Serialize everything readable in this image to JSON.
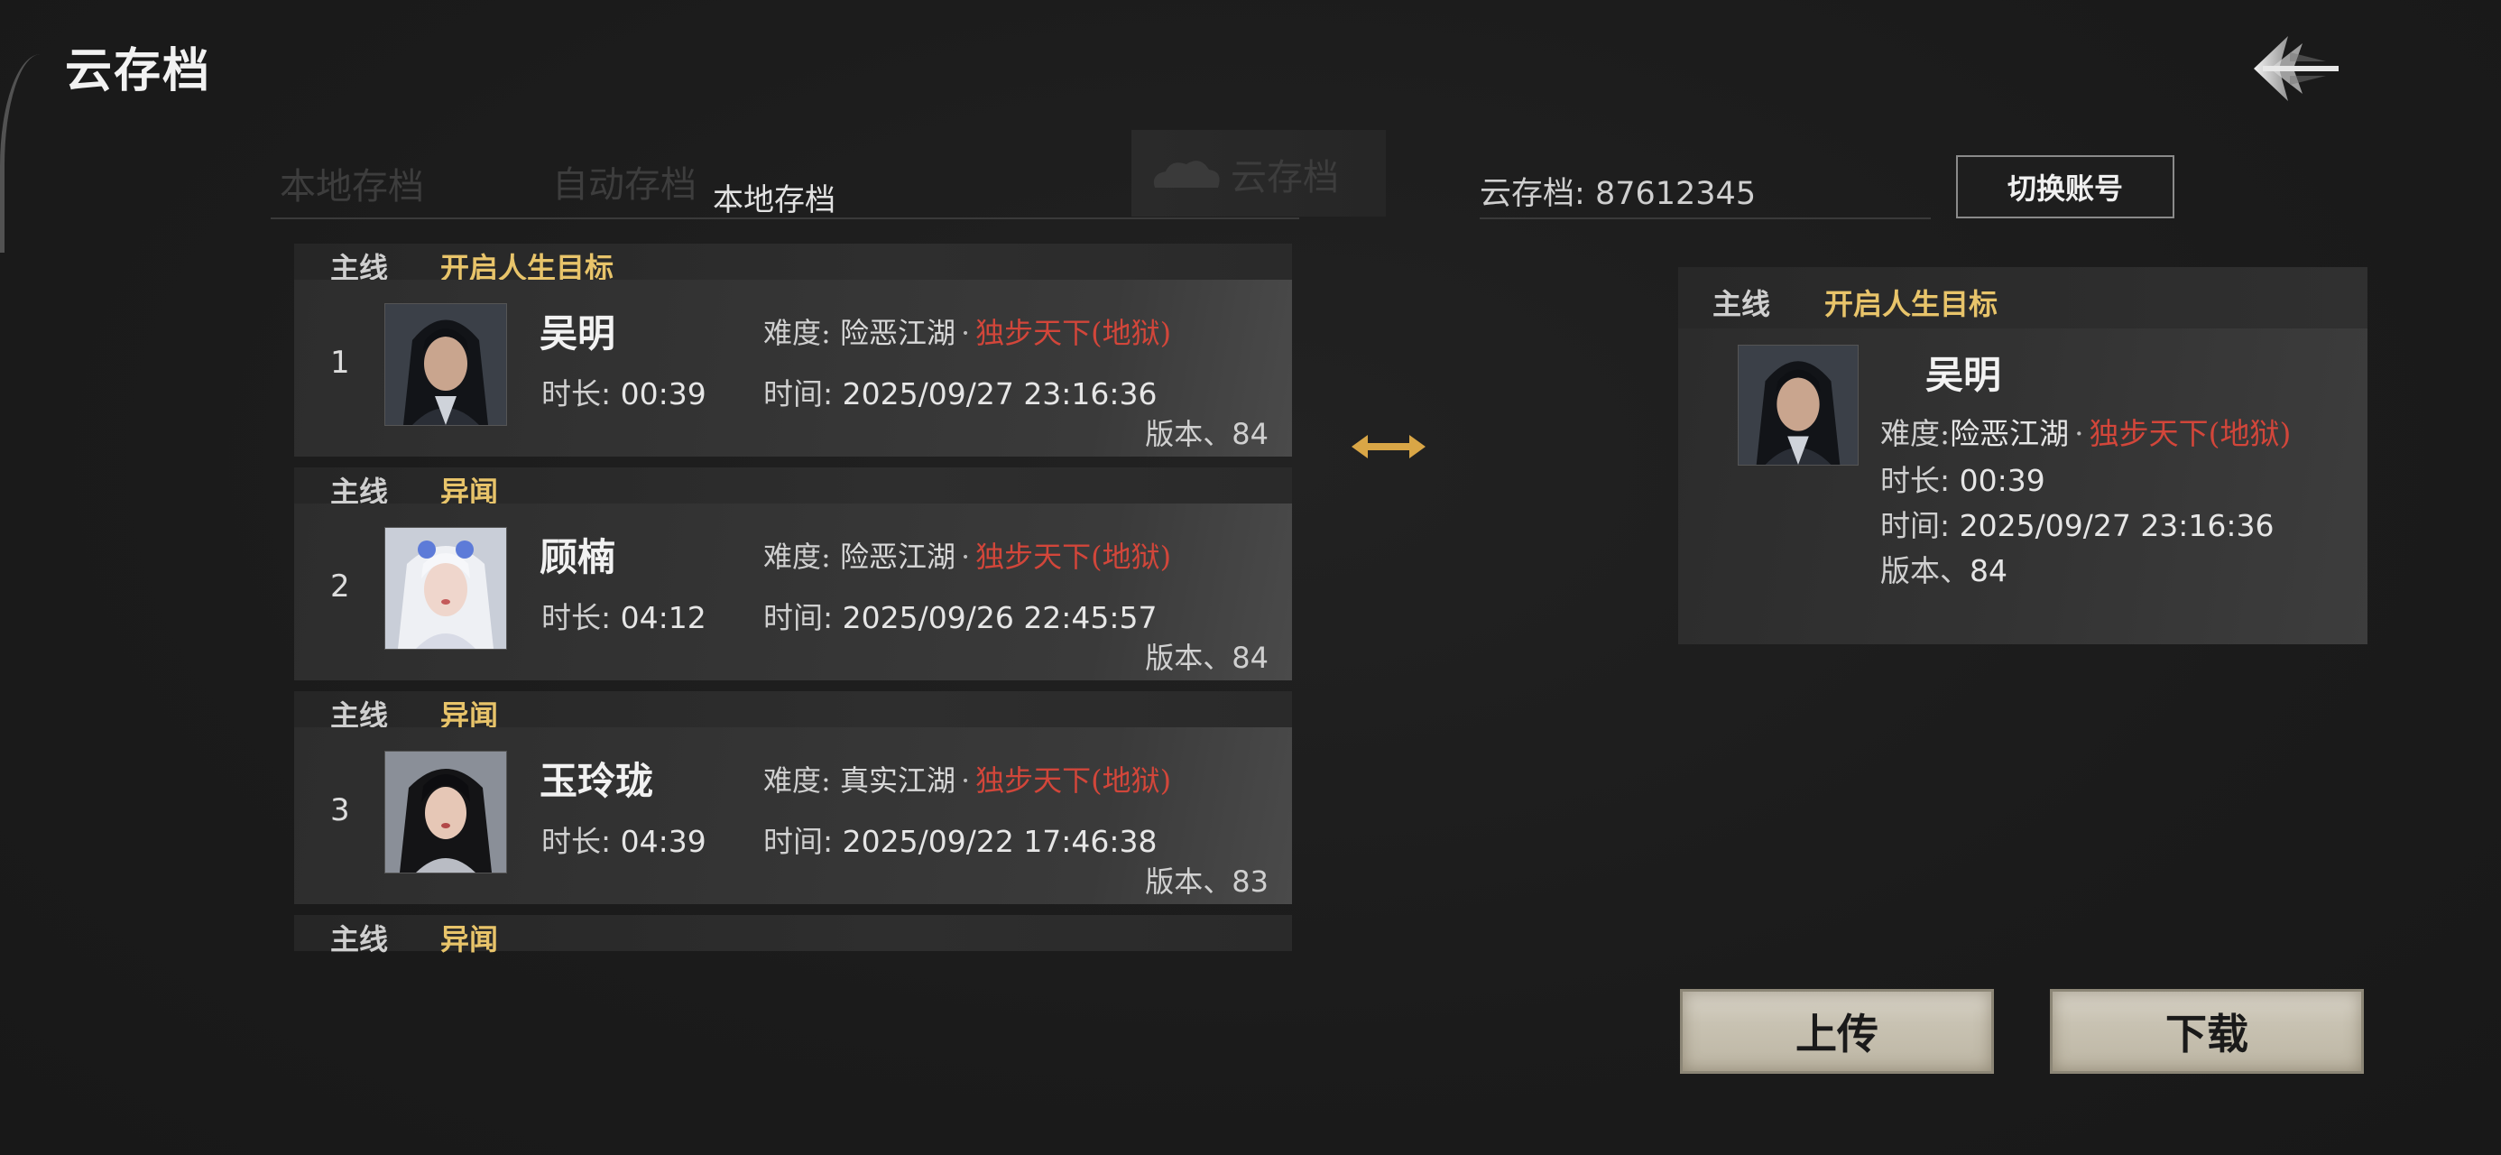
{
  "page": {
    "title": "云存档"
  },
  "tabs": {
    "local": "本地存档",
    "auto": "自动存档",
    "local_active_label": "本地存档",
    "cloud": "云存档"
  },
  "account": {
    "label": "云存档",
    "id": "87612345",
    "separator": ":",
    "switch_button": "切换账号"
  },
  "labels": {
    "difficulty": "难度:",
    "duration": "时长:",
    "time": "时间:",
    "version": "版本、",
    "dot": "·"
  },
  "saves": [
    {
      "index": "1",
      "tag_main": "主线",
      "tag_goal": "开启人生目标",
      "name": "吴明",
      "difficulty": "险恶江湖",
      "difficulty_mode": "独步天下(地狱)",
      "duration": "00:39",
      "time": "2025/09/27 23:16:36",
      "version": "84",
      "portrait_icon": "male-swordsman-portrait"
    },
    {
      "index": "2",
      "tag_main": "主线",
      "tag_goal": "异闻",
      "name": "顾楠",
      "difficulty": "险恶江湖",
      "difficulty_mode": "独步天下(地狱)",
      "duration": "04:12",
      "time": "2025/09/26 22:45:57",
      "version": "84",
      "portrait_icon": "white-haired-female-portrait"
    },
    {
      "index": "3",
      "tag_main": "主线",
      "tag_goal": "异闻",
      "name": "玉玲珑",
      "difficulty": "真实江湖",
      "difficulty_mode": "独步天下(地狱)",
      "duration": "04:39",
      "time": "2025/09/22 17:46:38",
      "version": "83",
      "portrait_icon": "black-haired-female-portrait"
    },
    {
      "tag_main": "主线",
      "tag_goal": "异闻"
    }
  ],
  "detail": {
    "tag_main": "主线",
    "tag_goal": "开启人生目标",
    "name": "吴明",
    "difficulty": "险恶江湖",
    "difficulty_mode": "独步天下(地狱)",
    "duration": "00:39",
    "time": "2025/09/27 23:16:36",
    "version": "84",
    "portrait_icon": "male-swordsman-portrait"
  },
  "actions": {
    "upload": "上传",
    "download": "下载"
  },
  "icons": {
    "back": "back-arrow-icon",
    "swap": "swap-arrow-icon"
  },
  "colors": {
    "gold": "#e8c46a",
    "red": "#d2463a",
    "background": "#1c1c1c"
  }
}
